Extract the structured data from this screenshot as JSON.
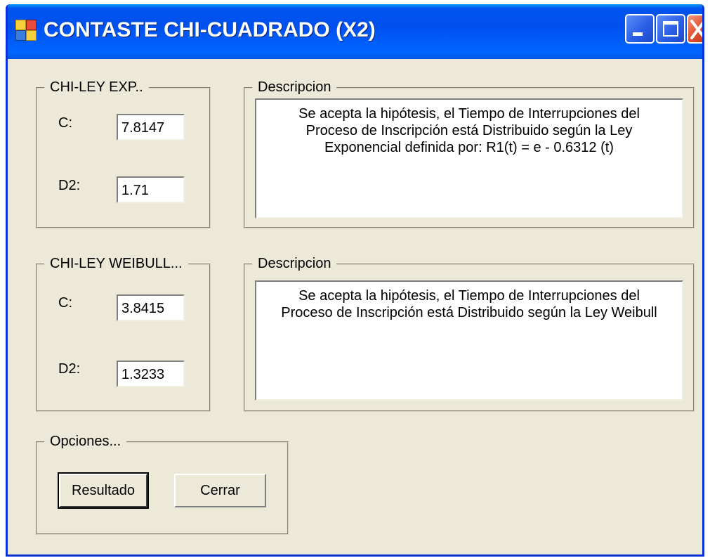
{
  "window": {
    "title": "CONTASTE CHI-CUADRADO (X2)",
    "controls": {
      "minimize_icon": "minimize-icon",
      "maximize_icon": "maximize-icon",
      "close_icon": "close-icon"
    }
  },
  "exp_group": {
    "legend": "CHI-LEY EXP..",
    "c_label": "C:",
    "c_value": "7.8147",
    "d2_label": "D2:",
    "d2_value": "1.71"
  },
  "exp_desc": {
    "legend": "Descripcion",
    "text": "Se acepta la hipótesis, el Tiempo de Interrupciones del\nProceso de Inscripción está  Distribuido según la Ley\n Exponencial definida por: R1(t) = e - 0.6312 (t)"
  },
  "weibull_group": {
    "legend": "CHI-LEY WEIBULL...",
    "c_label": "C:",
    "c_value": "3.8415",
    "d2_label": "D2:",
    "d2_value": "1.3233"
  },
  "weibull_desc": {
    "legend": "Descripcion",
    "text": "Se acepta la hipótesis, el Tiempo de Interrupciones del\nProceso de Inscripción está  Distribuido según la Ley Weibull"
  },
  "options": {
    "legend": "Opciones...",
    "result_button": "Resultado",
    "close_button": "Cerrar"
  },
  "colors": {
    "titlebar": "#0055e5",
    "window_bg": "#ece9d8",
    "close_button": "#e2512e"
  }
}
